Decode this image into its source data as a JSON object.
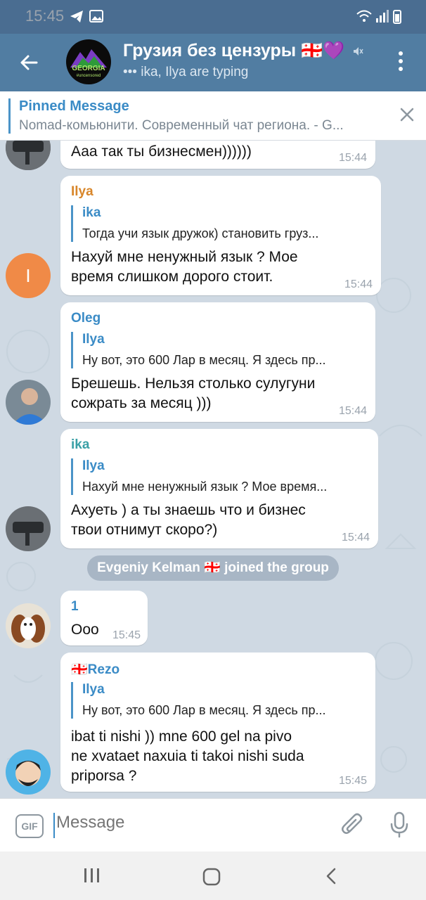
{
  "status": {
    "time": "15:45"
  },
  "header": {
    "title": "Грузия без цензуры 🇬🇪💜",
    "subtitle": "••• ika, Ilya are typing",
    "logo_text": "GEORGIA",
    "logo_sub": "#uncensored"
  },
  "pinned": {
    "title": "Pinned Message",
    "text": "Nomad-комьюнити. Современный чат региона. - G..."
  },
  "messages": [
    {
      "text": "Ааа так ты бизнесмен))))))",
      "time": "15:44"
    },
    {
      "sender": "Ilya",
      "reply_name": "ika",
      "reply_text": "Тогда учи язык дружок)  становить груз...",
      "line1": "Нахуй мне ненужный язык ? Мое",
      "line2": "время слишком дорого стоит.",
      "time": "15:44",
      "avatar_letter": "I"
    },
    {
      "sender": "Oleg",
      "reply_name": "Ilya",
      "reply_text": "Ну вот, это 600 Лар в месяц. Я здесь пр...",
      "line1": "Брешешь. Нельзя столько сулугуни",
      "line2": "сожрать за месяц )))",
      "time": "15:44"
    },
    {
      "sender": "ika",
      "reply_name": "Ilya",
      "reply_text": "Нахуй мне ненужный язык ? Мое время...",
      "line1": "Ахуеть ) а ты знаешь что и бизнес",
      "line2": "твои отнимут скоро?)",
      "time": "15:44"
    },
    {
      "sender": "1",
      "text": "Ооо",
      "time": "15:45"
    },
    {
      "sender": "🇬🇪Rezo",
      "reply_name": "Ilya",
      "reply_text": "Ну вот, это 600 Лар в месяц. Я здесь пр...",
      "line1": "ibat ti nishi )) mne 600 gel na pivo",
      "line2": "ne xvataet naxuia ti takoi nishi suda",
      "line3": "priporsa ?",
      "time": "15:45"
    }
  ],
  "service": {
    "text": "Evgeniy Kelman 🇬🇪 joined the group"
  },
  "input": {
    "placeholder": "Message",
    "gif_label": "GIF"
  },
  "colors": {
    "header": "#517da2",
    "accent": "#3a8bc6",
    "ilya": "#d8862a",
    "ika": "#3aa0a6",
    "oleg": "#3a8bc6",
    "one": "#3a8bc6",
    "rezo": "#3a8bc6"
  },
  "icons": [
    "telegram-icon",
    "gallery-icon",
    "wifi-icon",
    "signal-icon",
    "battery-icon",
    "back-arrow-icon",
    "mute-icon",
    "more-vert-icon",
    "close-icon",
    "attach-icon",
    "mic-icon",
    "recents-icon",
    "home-icon",
    "nav-back-icon"
  ]
}
